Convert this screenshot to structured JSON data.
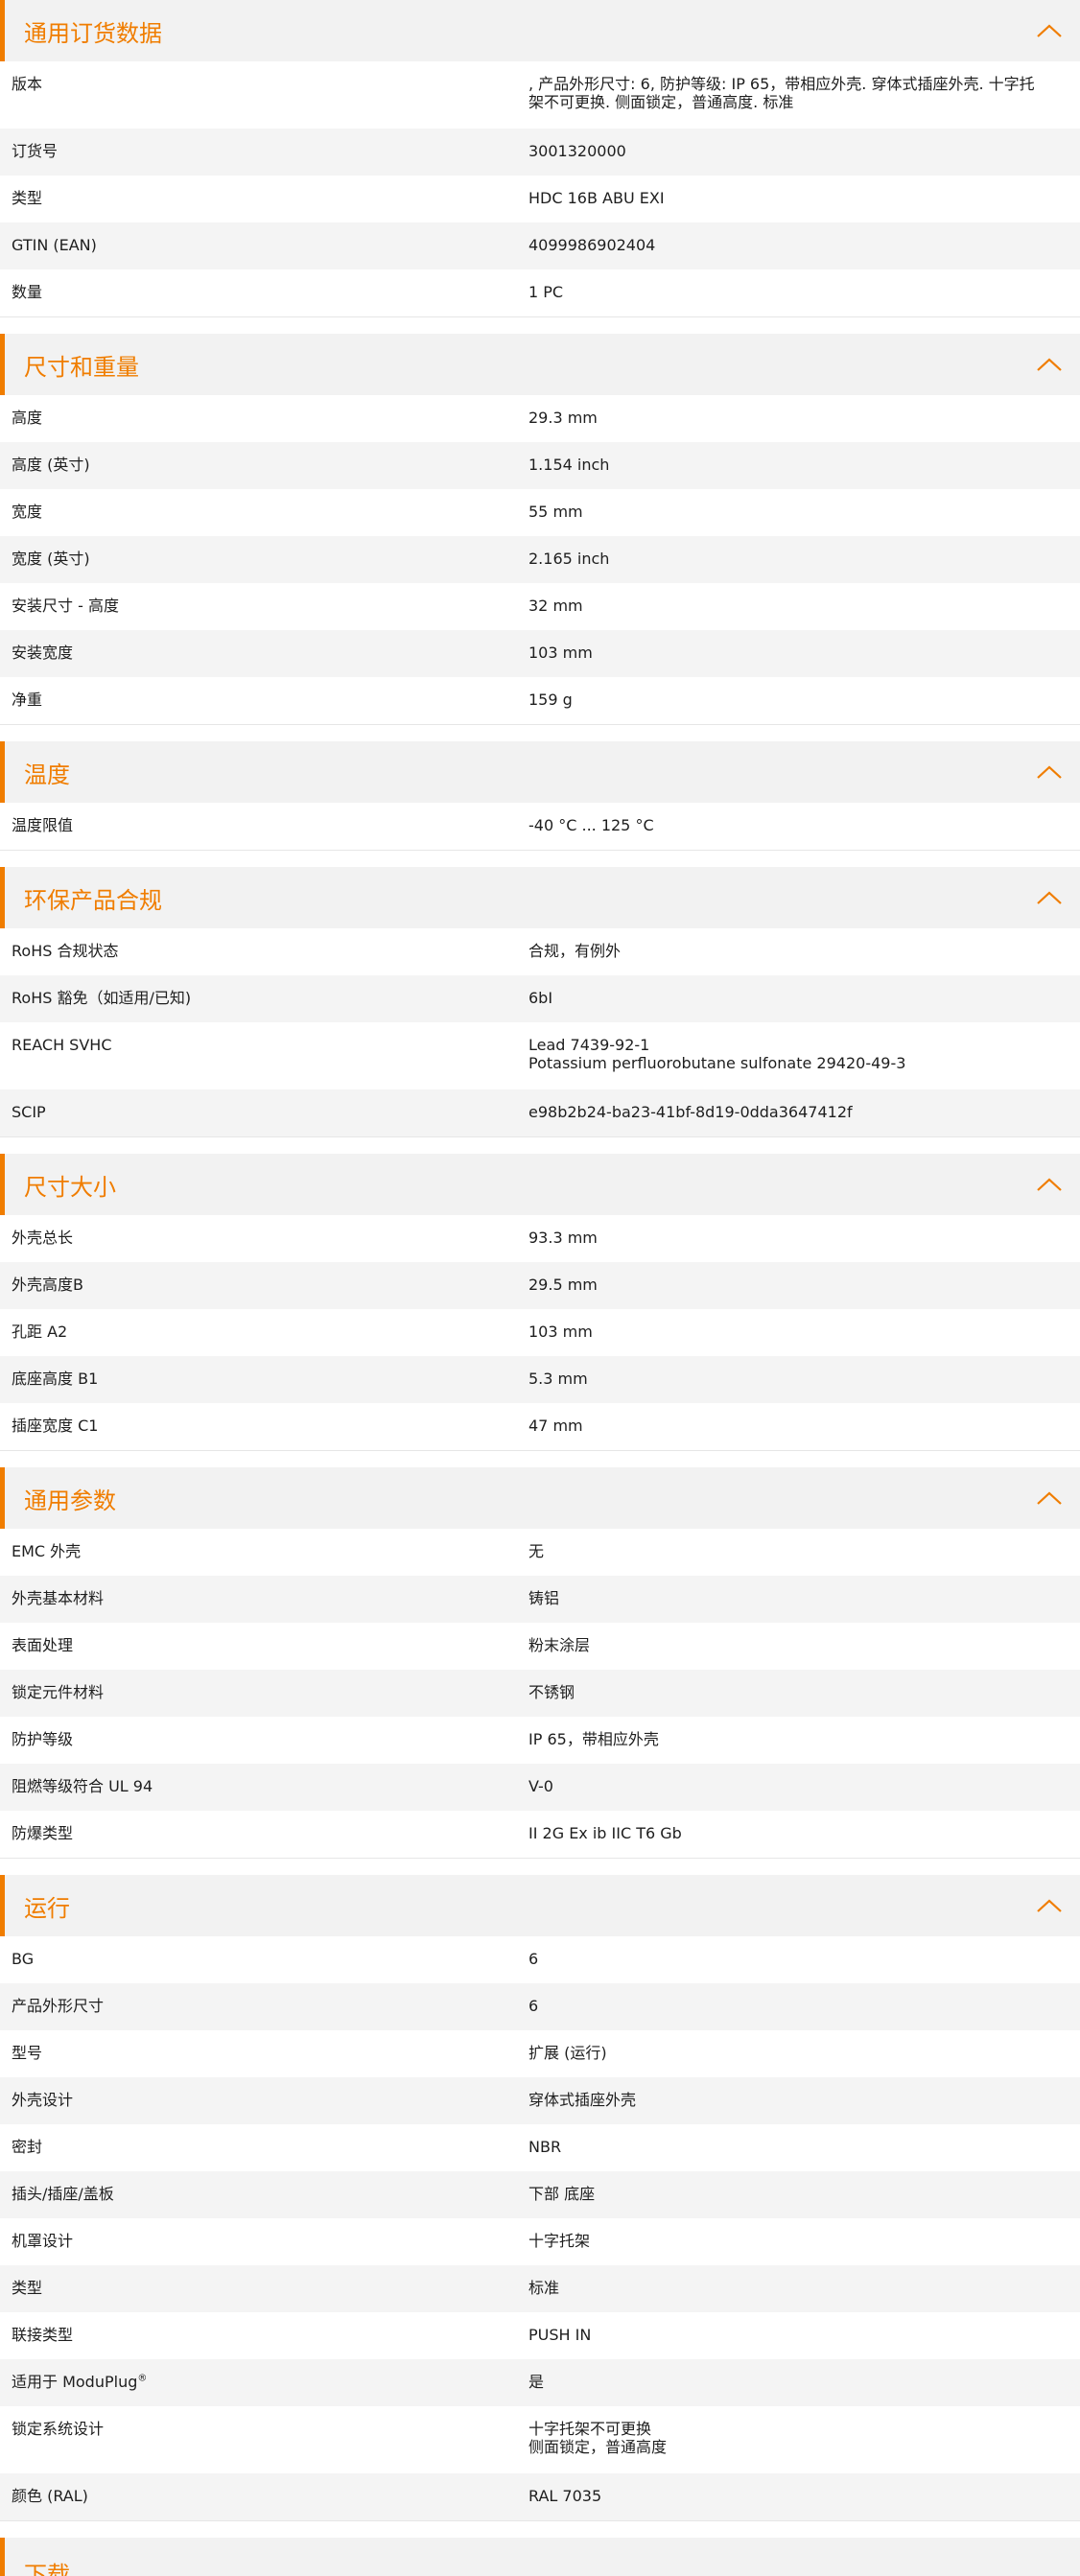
{
  "accent": "#f07d00",
  "sections": [
    {
      "title": "通用订货数据",
      "rows": [
        {
          "label": "版本",
          "value": ", 产品外形尺寸: 6, 防护等级: IP 65，带相应外壳. 穿体式插座外壳. 十字托",
          "value2": "架不可更换. 侧面锁定，普通高度. 标准"
        },
        {
          "label": "订货号",
          "value": "3001320000"
        },
        {
          "label": "类型",
          "value": "HDC 16B ABU EXI"
        },
        {
          "label": "GTIN (EAN)",
          "value": "4099986902404"
        },
        {
          "label": "数量",
          "value": "1  PC"
        }
      ]
    },
    {
      "title": "尺寸和重量",
      "rows": [
        {
          "label": "高度",
          "value": "29.3  mm"
        },
        {
          "label": "高度 (英寸)",
          "value": "1.154  inch"
        },
        {
          "label": "宽度",
          "value": "55  mm"
        },
        {
          "label": "宽度 (英寸)",
          "value": "2.165  inch"
        },
        {
          "label": "安装尺寸 - 高度",
          "value": "32  mm"
        },
        {
          "label": "安装宽度",
          "value": "103  mm"
        },
        {
          "label": "净重",
          "value": "159  g"
        }
      ]
    },
    {
      "title": "温度",
      "rows": [
        {
          "label": "温度限值",
          "value": "-40 °C ... 125 °C"
        }
      ]
    },
    {
      "title": "环保产品合规",
      "rows": [
        {
          "label": "RoHS 合规状态",
          "value": "合规，有例外"
        },
        {
          "label": "RoHS 豁免（如适用/已知)",
          "value": "6bI"
        },
        {
          "label": "REACH SVHC",
          "value": "Lead 7439-92-1",
          "value2": "Potassium perfluorobutane sulfonate 29420-49-3"
        },
        {
          "label": "SCIP",
          "value": "e98b2b24-ba23-41bf-8d19-0dda3647412f"
        }
      ]
    },
    {
      "title": "尺寸大小",
      "rows": [
        {
          "label": "外壳总长",
          "value": "93.3  mm"
        },
        {
          "label": "外壳高度B",
          "value": "29.5  mm"
        },
        {
          "label": "孔距 A2",
          "value": "103  mm"
        },
        {
          "label": "底座高度 B1",
          "value": "5.3  mm"
        },
        {
          "label": "插座宽度 C1",
          "value": "47  mm"
        }
      ]
    },
    {
      "title": "通用参数",
      "rows": [
        {
          "label": "EMC 外壳",
          "value": "无"
        },
        {
          "label": "外壳基本材料",
          "value": "铸铝"
        },
        {
          "label": "表面处理",
          "value": "粉末涂层"
        },
        {
          "label": "锁定元件材料",
          "value": "不锈钢"
        },
        {
          "label": "防护等级",
          "value": "IP 65，带相应外壳"
        },
        {
          "label": "阻燃等级符合 UL 94",
          "value": "V-0"
        },
        {
          "label": "防爆类型",
          "value": "II 2G Ex ib IIC T6 Gb"
        }
      ]
    },
    {
      "title": "运行",
      "rows": [
        {
          "label": "BG",
          "value": "6"
        },
        {
          "label": "产品外形尺寸",
          "value": "6"
        },
        {
          "label": "型号",
          "value": "扩展 (运行)"
        },
        {
          "label": "外壳设计",
          "value": "穿体式插座外壳"
        },
        {
          "label": "密封",
          "value": "NBR"
        },
        {
          "label": "插头/插座/盖板",
          "value": "下部 底座"
        },
        {
          "label": "机罩设计",
          "value": "十字托架"
        },
        {
          "label": "类型",
          "value": "标准"
        },
        {
          "label": "联接类型",
          "value": "PUSH IN"
        },
        {
          "label": "适用于 ModuPlug",
          "label_sup": "®",
          "value": "是"
        },
        {
          "label": "锁定系统设计",
          "value": "十字托架不可更换",
          "value2": "侧面锁定，普通高度"
        },
        {
          "label": "颜色 (RAL)",
          "value": "RAL 7035"
        }
      ]
    }
  ],
  "partial_section": {
    "title": "下载"
  }
}
